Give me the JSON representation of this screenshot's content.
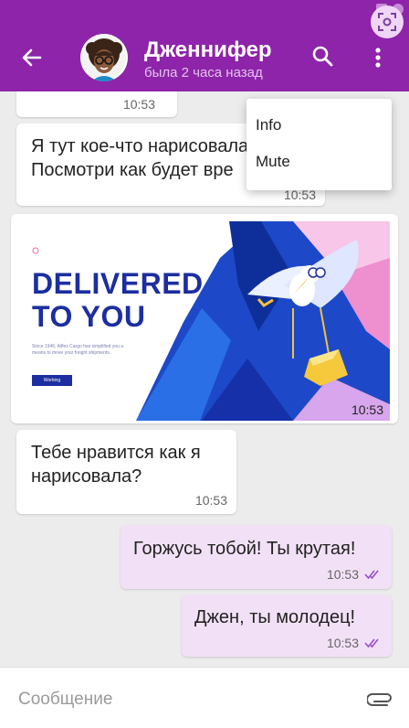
{
  "header": {
    "contact_name": "Дженнифер",
    "last_seen": "была 2 часа назад"
  },
  "menu": {
    "items": [
      {
        "label": "Info"
      },
      {
        "label": "Mute"
      }
    ]
  },
  "messages": [
    {
      "text": "",
      "time": "10:53"
    },
    {
      "text": "Я тут кое-что нарисовала. Посмотри как будет выглядеть",
      "line1": "Я тут кое-что нарисовала.",
      "line2": "Посмотри как будет вре",
      "time": "10:53"
    },
    {
      "image": {
        "headline_1": "DELIVERED",
        "headline_2": "TO YOU",
        "small_text": "Since 1946, Aiflex Cargo has simplified you a means to move your freight shipments.",
        "button_label": "Working"
      },
      "time": "10:53"
    },
    {
      "line1": "Тебе нравится как я",
      "line2": "нарисовала?",
      "time": "10:53"
    },
    {
      "text": "Горжусь тобой! Ты крутая!",
      "time": "10:53",
      "read": true
    },
    {
      "text": "Джен, ты молодец!",
      "time": "10:53",
      "read": true
    }
  ],
  "composer": {
    "placeholder": "Сообщение"
  },
  "colors": {
    "appbar": "#8e24aa",
    "outgoing_bubble": "#f2e1f6",
    "read_ticks": "#9c4dcc"
  },
  "icons": [
    "back-arrow-icon",
    "search-icon",
    "more-vert-icon",
    "camera-scan-icon",
    "attach-icon",
    "double-check-icon"
  ]
}
